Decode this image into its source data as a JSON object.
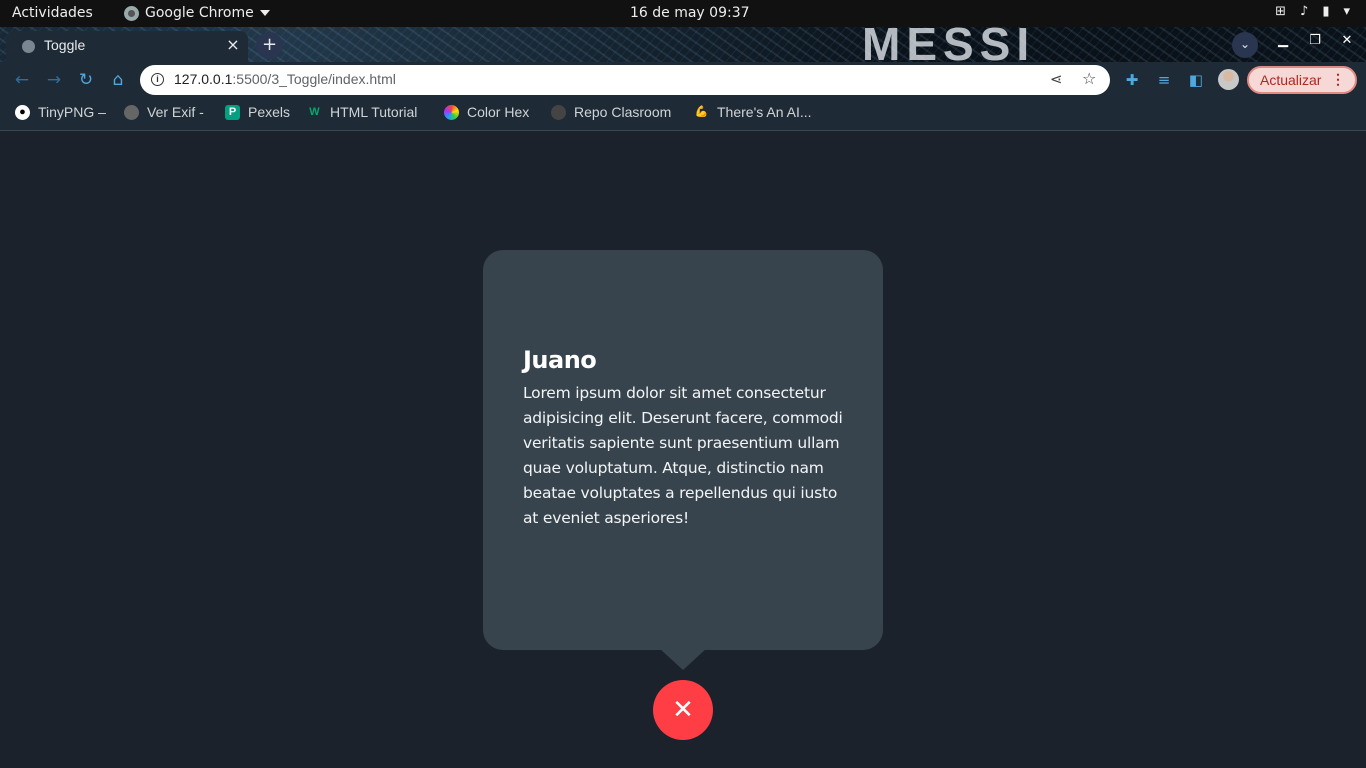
{
  "os_bar": {
    "activities": "Actividades",
    "app_name": "Google Chrome",
    "clock": "16 de may  09:37"
  },
  "browser": {
    "tab_title": "Toggle",
    "tab_close": "×",
    "new_tab": "+",
    "wallpaper_text": "MESSI",
    "url_host": "127.0.0.1",
    "url_path": ":5500/3_Toggle/index.html",
    "update_label": "Actualizar",
    "menu_glyph": "⋮"
  },
  "bookmarks": [
    {
      "label": "TinyPNG –",
      "icon": "panda-icon",
      "color": "#ffffff"
    },
    {
      "label": "Ver Exif -",
      "icon": "globe-icon",
      "color": "#888888"
    },
    {
      "label": "Pexels",
      "icon": "pexels-icon",
      "color": "#05a081"
    },
    {
      "label": "HTML Tutorial",
      "icon": "w3schools-icon",
      "color": "#04aa6d"
    },
    {
      "label": "Color Hex",
      "icon": "colorhex-icon",
      "color": "#e44"
    },
    {
      "label": "Repo Clasroom",
      "icon": "github-icon",
      "color": "#777777"
    },
    {
      "label": "There's An AI...",
      "icon": "arm-icon",
      "color": "#dddddd"
    }
  ],
  "card": {
    "name": "Juano",
    "text": "Lorem ipsum dolor sit amet consectetur adipisicing elit. Deserunt facere, commodi veritatis sapiente sunt praesentium ullam quae voluptatum. Atque, distinctio nam beatae voluptates a repellendus qui iusto at eveniet asperiores!"
  },
  "toggle": {
    "glyph": "✕",
    "color": "#ff3d45"
  },
  "colors": {
    "page_bg": "#1b222b",
    "card_bg": "#37444e",
    "accent": "#4fa8de"
  }
}
